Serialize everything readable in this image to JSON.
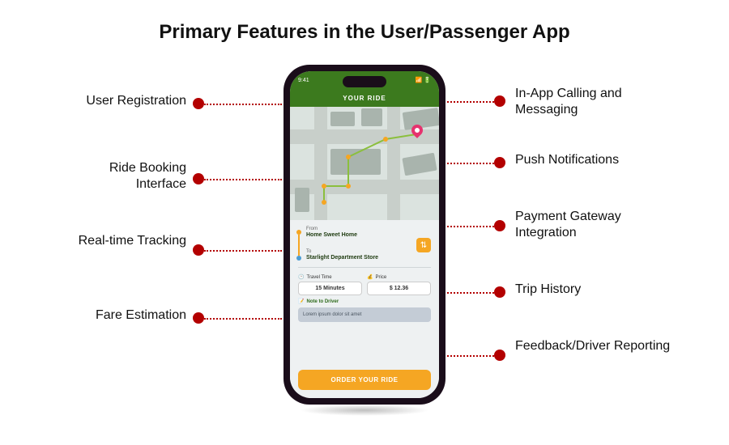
{
  "title": "Primary Features in the User/Passenger App",
  "phone": {
    "statusbar_time": "9:41",
    "appbar_title": "YOUR RIDE",
    "from_label": "From",
    "from_value": "Home Sweet Home",
    "to_label": "To",
    "to_value": "Starlight Department Store",
    "travel_time_label": "Travel Time",
    "travel_time_value": "15 Minutes",
    "price_label": "Price",
    "price_value": "$ 12.36",
    "note_label": "Note to Driver",
    "note_placeholder": "Lorem ipsum dolor sit amet",
    "order_button": "ORDER YOUR RIDE"
  },
  "features_left": [
    "User Registration",
    "Ride Booking Interface",
    "Real-time Tracking",
    "Fare Estimation"
  ],
  "features_right": [
    "In-App Calling and Messaging",
    "Push Notifications",
    "Payment Gateway Integration",
    "Trip History",
    "Feedback/Driver Reporting"
  ],
  "colors": {
    "accent_red": "#b30000",
    "brand_green": "#3c7a1e",
    "accent_orange": "#f5a623"
  }
}
